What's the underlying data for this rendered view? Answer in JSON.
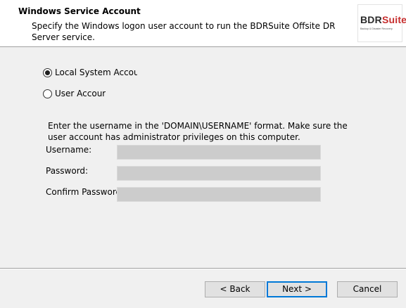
{
  "header": {
    "title": "Windows Service Account",
    "subtitle": "Specify the Windows logon user account to run the BDRSuite Offsite DR Server service.",
    "logo": {
      "text_part1": "BDR",
      "text_part2": "Suite",
      "tagline": "Backup & Disaster Recovery",
      "accent_color": "#c62d2d"
    }
  },
  "account_type": {
    "options": [
      {
        "label": "Local System Accour",
        "checked": true
      },
      {
        "label": "User Accour",
        "checked": false
      }
    ]
  },
  "info_text": "Enter the username in the 'DOMAIN\\USERNAME' format. Make sure the user account has administrator privileges on this computer.",
  "fields": {
    "username_label": "Username:",
    "username_value": "",
    "password_label": "Password:",
    "password_value": "",
    "confirm_label": "Confirm Passworc",
    "confirm_value": ""
  },
  "buttons": {
    "back": "< Back",
    "next": "Next >",
    "cancel": "Cancel"
  }
}
